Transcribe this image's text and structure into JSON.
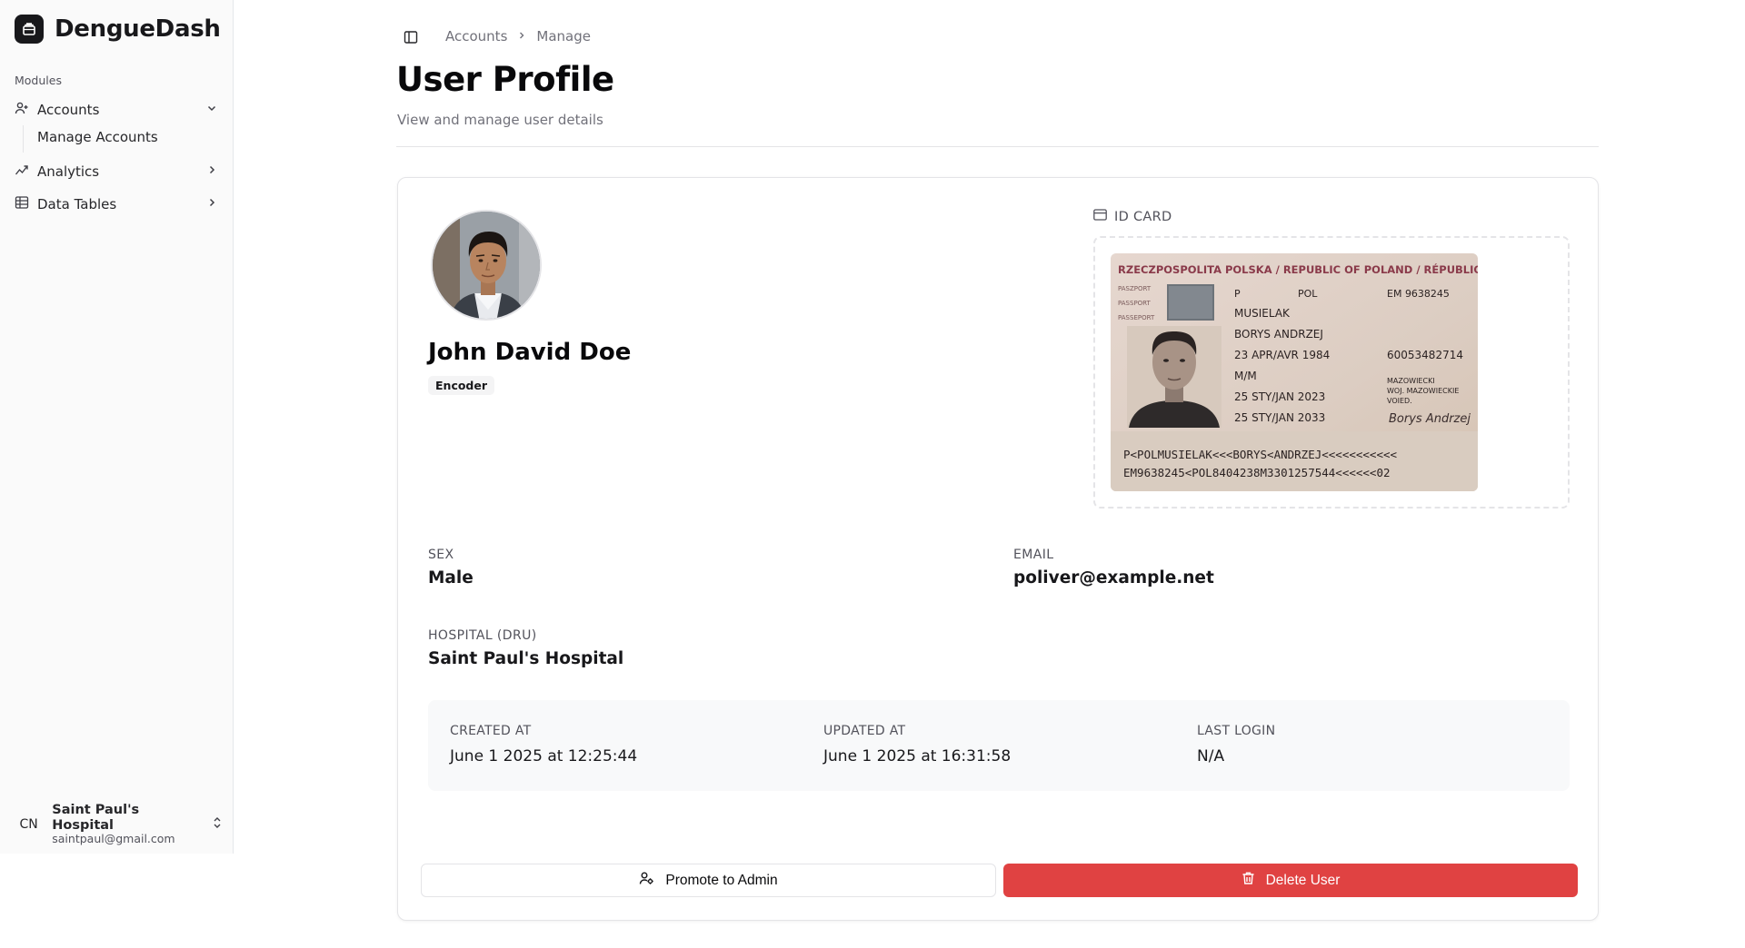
{
  "app": {
    "name": "DengueDash"
  },
  "sidebar": {
    "section_label": "Modules",
    "items": [
      {
        "label": "Accounts",
        "icon": "user-plus-icon",
        "expanded": true,
        "children": [
          {
            "label": "Manage Accounts"
          }
        ]
      },
      {
        "label": "Analytics",
        "icon": "trend-chart-icon",
        "expanded": false
      },
      {
        "label": "Data Tables",
        "icon": "table-icon",
        "expanded": false
      }
    ],
    "user": {
      "initials": "CN",
      "name": "Saint Paul's Hospital",
      "email": "saintpaul@gmail.com"
    }
  },
  "header": {
    "breadcrumb": [
      "Accounts",
      "Manage"
    ],
    "title": "User Profile",
    "subtitle": "View and manage user details"
  },
  "profile": {
    "full_name": "John David Doe",
    "role": "Encoder",
    "id_card_label": "ID CARD",
    "id_card": {
      "header": "RZECZPOSPOLITA POLSKA / REPUBLIC OF POLAND / RÉPUBLIQUE DE",
      "doc_type_left": [
        "PASZPORT",
        "PASSPORT",
        "PASSEPORT"
      ],
      "type": "P",
      "country": "POL",
      "number": "EM 9638245",
      "surname": "MUSIELAK",
      "given_names": "BORYS ANDRZEJ",
      "birth_date": "23 APR/AVR 1984",
      "personal_no": "60053482714",
      "sex": "M/M",
      "authority": [
        "MAZOWIECKI",
        "WOJ. MAZOWIECKIE",
        "VOIED."
      ],
      "issue_date": "25 STY/JAN 2023",
      "expiry_date": "25 STY/JAN 2033",
      "signature": "Borys Andrzej",
      "mrz_line1": "P<POLMUSIELAK<<<BORYS<ANDRZEJ<<<<<<<<<<<",
      "mrz_line2": "EM9638245<POL8404238M3301257544<<<<<<02"
    },
    "fields": {
      "sex_label": "SEX",
      "sex": "Male",
      "email_label": "EMAIL",
      "email": "poliver@example.net",
      "hospital_label": "HOSPITAL (DRU)",
      "hospital": "Saint Paul's Hospital"
    },
    "meta": {
      "created_label": "CREATED AT",
      "created": "June 1 2025 at 12:25:44",
      "updated_label": "UPDATED AT",
      "updated": "June 1 2025 at 16:31:58",
      "login_label": "LAST LOGIN",
      "login": "N/A"
    },
    "actions": {
      "promote_label": "Promote to Admin",
      "delete_label": "Delete User"
    }
  },
  "colors": {
    "accent_dark": "#18181b",
    "danger": "#e04242",
    "muted_text": "#71717a",
    "border": "#e4e4e7"
  }
}
